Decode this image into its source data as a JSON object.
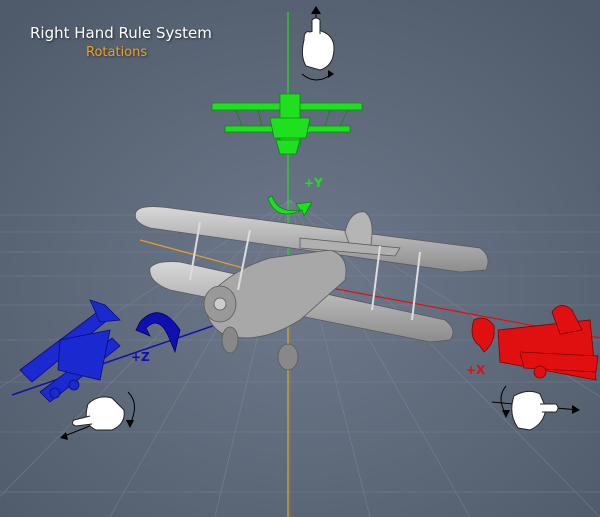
{
  "header": {
    "title": "Right Hand Rule System",
    "subtitle": "Rotations"
  },
  "axes": {
    "y_label": "+Y",
    "z_label": "+Z",
    "x_label": "+X"
  },
  "colors": {
    "background": "#5f6b7c",
    "grid": "#8a95a5",
    "y_axis": "#1fe01f",
    "z_axis": "#1010b0",
    "x_axis": "#e01010",
    "vertical_axis": "#e8a020",
    "plane_gray": "#bfbfbf"
  },
  "icons": [
    "right-hand-thumb-up-icon",
    "right-hand-thumb-left-icon",
    "right-hand-thumb-right-icon",
    "rotation-arrow-icon"
  ]
}
